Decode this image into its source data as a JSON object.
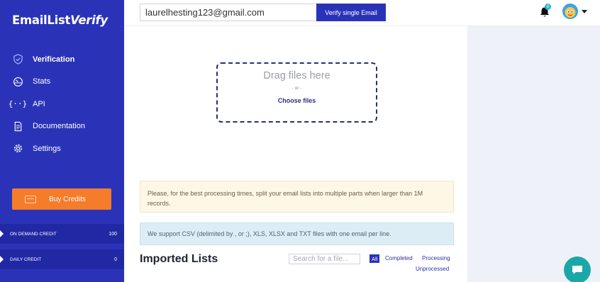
{
  "app": {
    "logo_main": "EmailList",
    "logo_accent": "Verify"
  },
  "sidebar": {
    "items": [
      {
        "label": "Verification",
        "icon": "shield-check-icon",
        "active": true
      },
      {
        "label": "Stats",
        "icon": "gauge-icon",
        "active": false
      },
      {
        "label": "API",
        "icon": "code-braces-icon",
        "active": false
      },
      {
        "label": "Documentation",
        "icon": "document-icon",
        "active": false
      },
      {
        "label": "Settings",
        "icon": "gear-icon",
        "active": false
      }
    ],
    "buy_credits_label": "Buy Credits",
    "credits": [
      {
        "label": "ON DEMAND CREDIT",
        "value": "100"
      },
      {
        "label": "DAILY CREDIT",
        "value": "0"
      }
    ]
  },
  "header": {
    "email_value": "laurelhesting123@gmail.com",
    "verify_label": "Verify single Email",
    "notification_count": "0"
  },
  "dropzone": {
    "title": "Drag files here",
    "or": "- or -",
    "choose": "Choose files"
  },
  "notes": {
    "warning": "Please, for the best processing times, split your email lists into multiple parts when larger than 1M records.",
    "info": "We support CSV (delimited by , or ;), XLS, XLSX and TXT files with one email per line."
  },
  "imported": {
    "title": "Imported Lists",
    "search_placeholder": "Search for a file...",
    "filters": {
      "all": "All",
      "completed": "Completed",
      "processing": "Processing",
      "unprocessed": "Unprocessed"
    }
  },
  "colors": {
    "sidebar": "#2a33b8",
    "accent_orange": "#f57c2a",
    "chat": "#1aa7a7"
  }
}
